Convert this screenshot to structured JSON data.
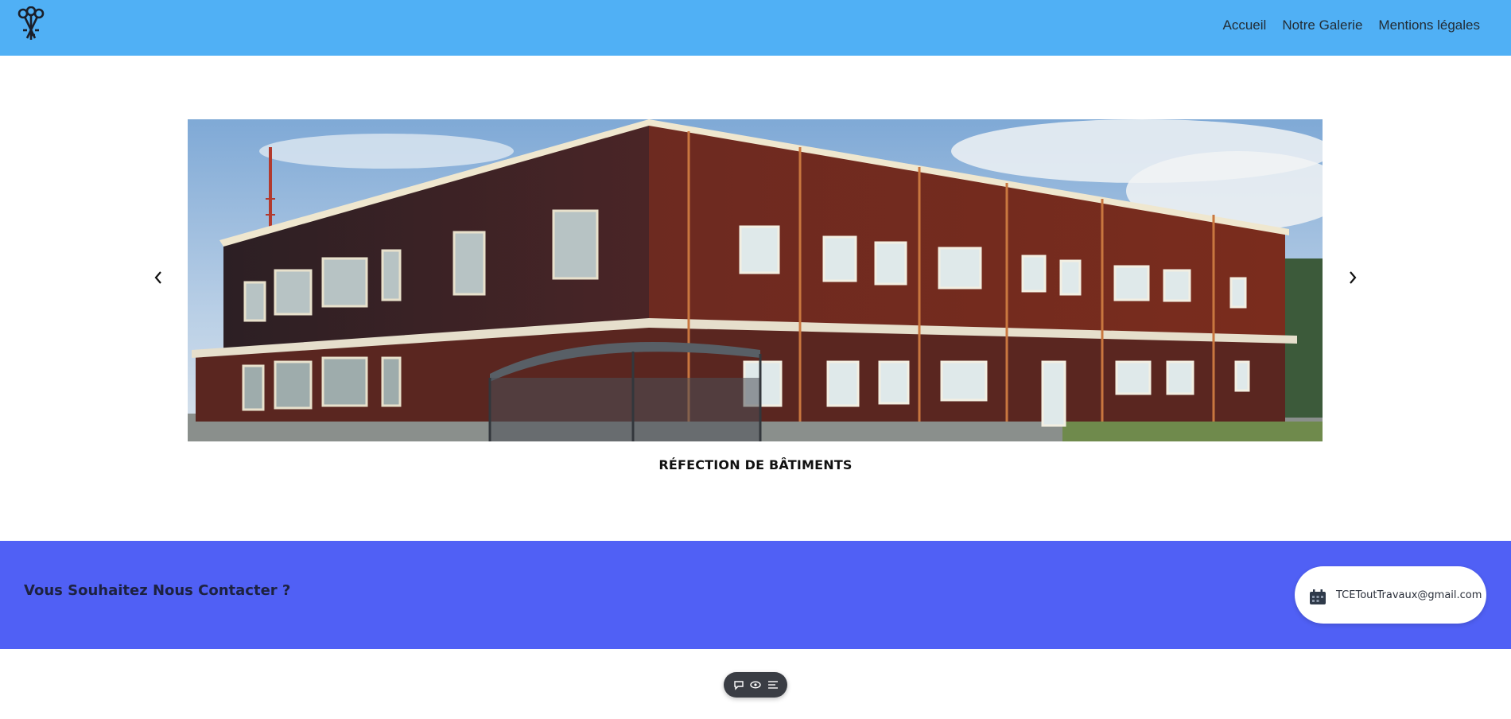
{
  "nav": {
    "items": [
      {
        "label": "Accueil"
      },
      {
        "label": "Notre Galerie"
      },
      {
        "label": "Mentions légales"
      }
    ]
  },
  "carousel": {
    "caption": "RÉFECTION DE BÂTIMENTS",
    "prev_icon": "chevron-left-icon",
    "next_icon": "chevron-right-icon"
  },
  "contact": {
    "title": "Vous Souhaitez Nous Contacter ?",
    "email": "TCEToutTravaux@gmail.com",
    "email_icon": "calendar-icon"
  },
  "toolbar": {
    "icons": [
      "comment-icon",
      "eye-icon",
      "list-settings-icon"
    ]
  },
  "colors": {
    "header_bg": "#50b0f5",
    "contact_bg": "#5060f5",
    "toolbar_bg": "#3a3d44"
  }
}
